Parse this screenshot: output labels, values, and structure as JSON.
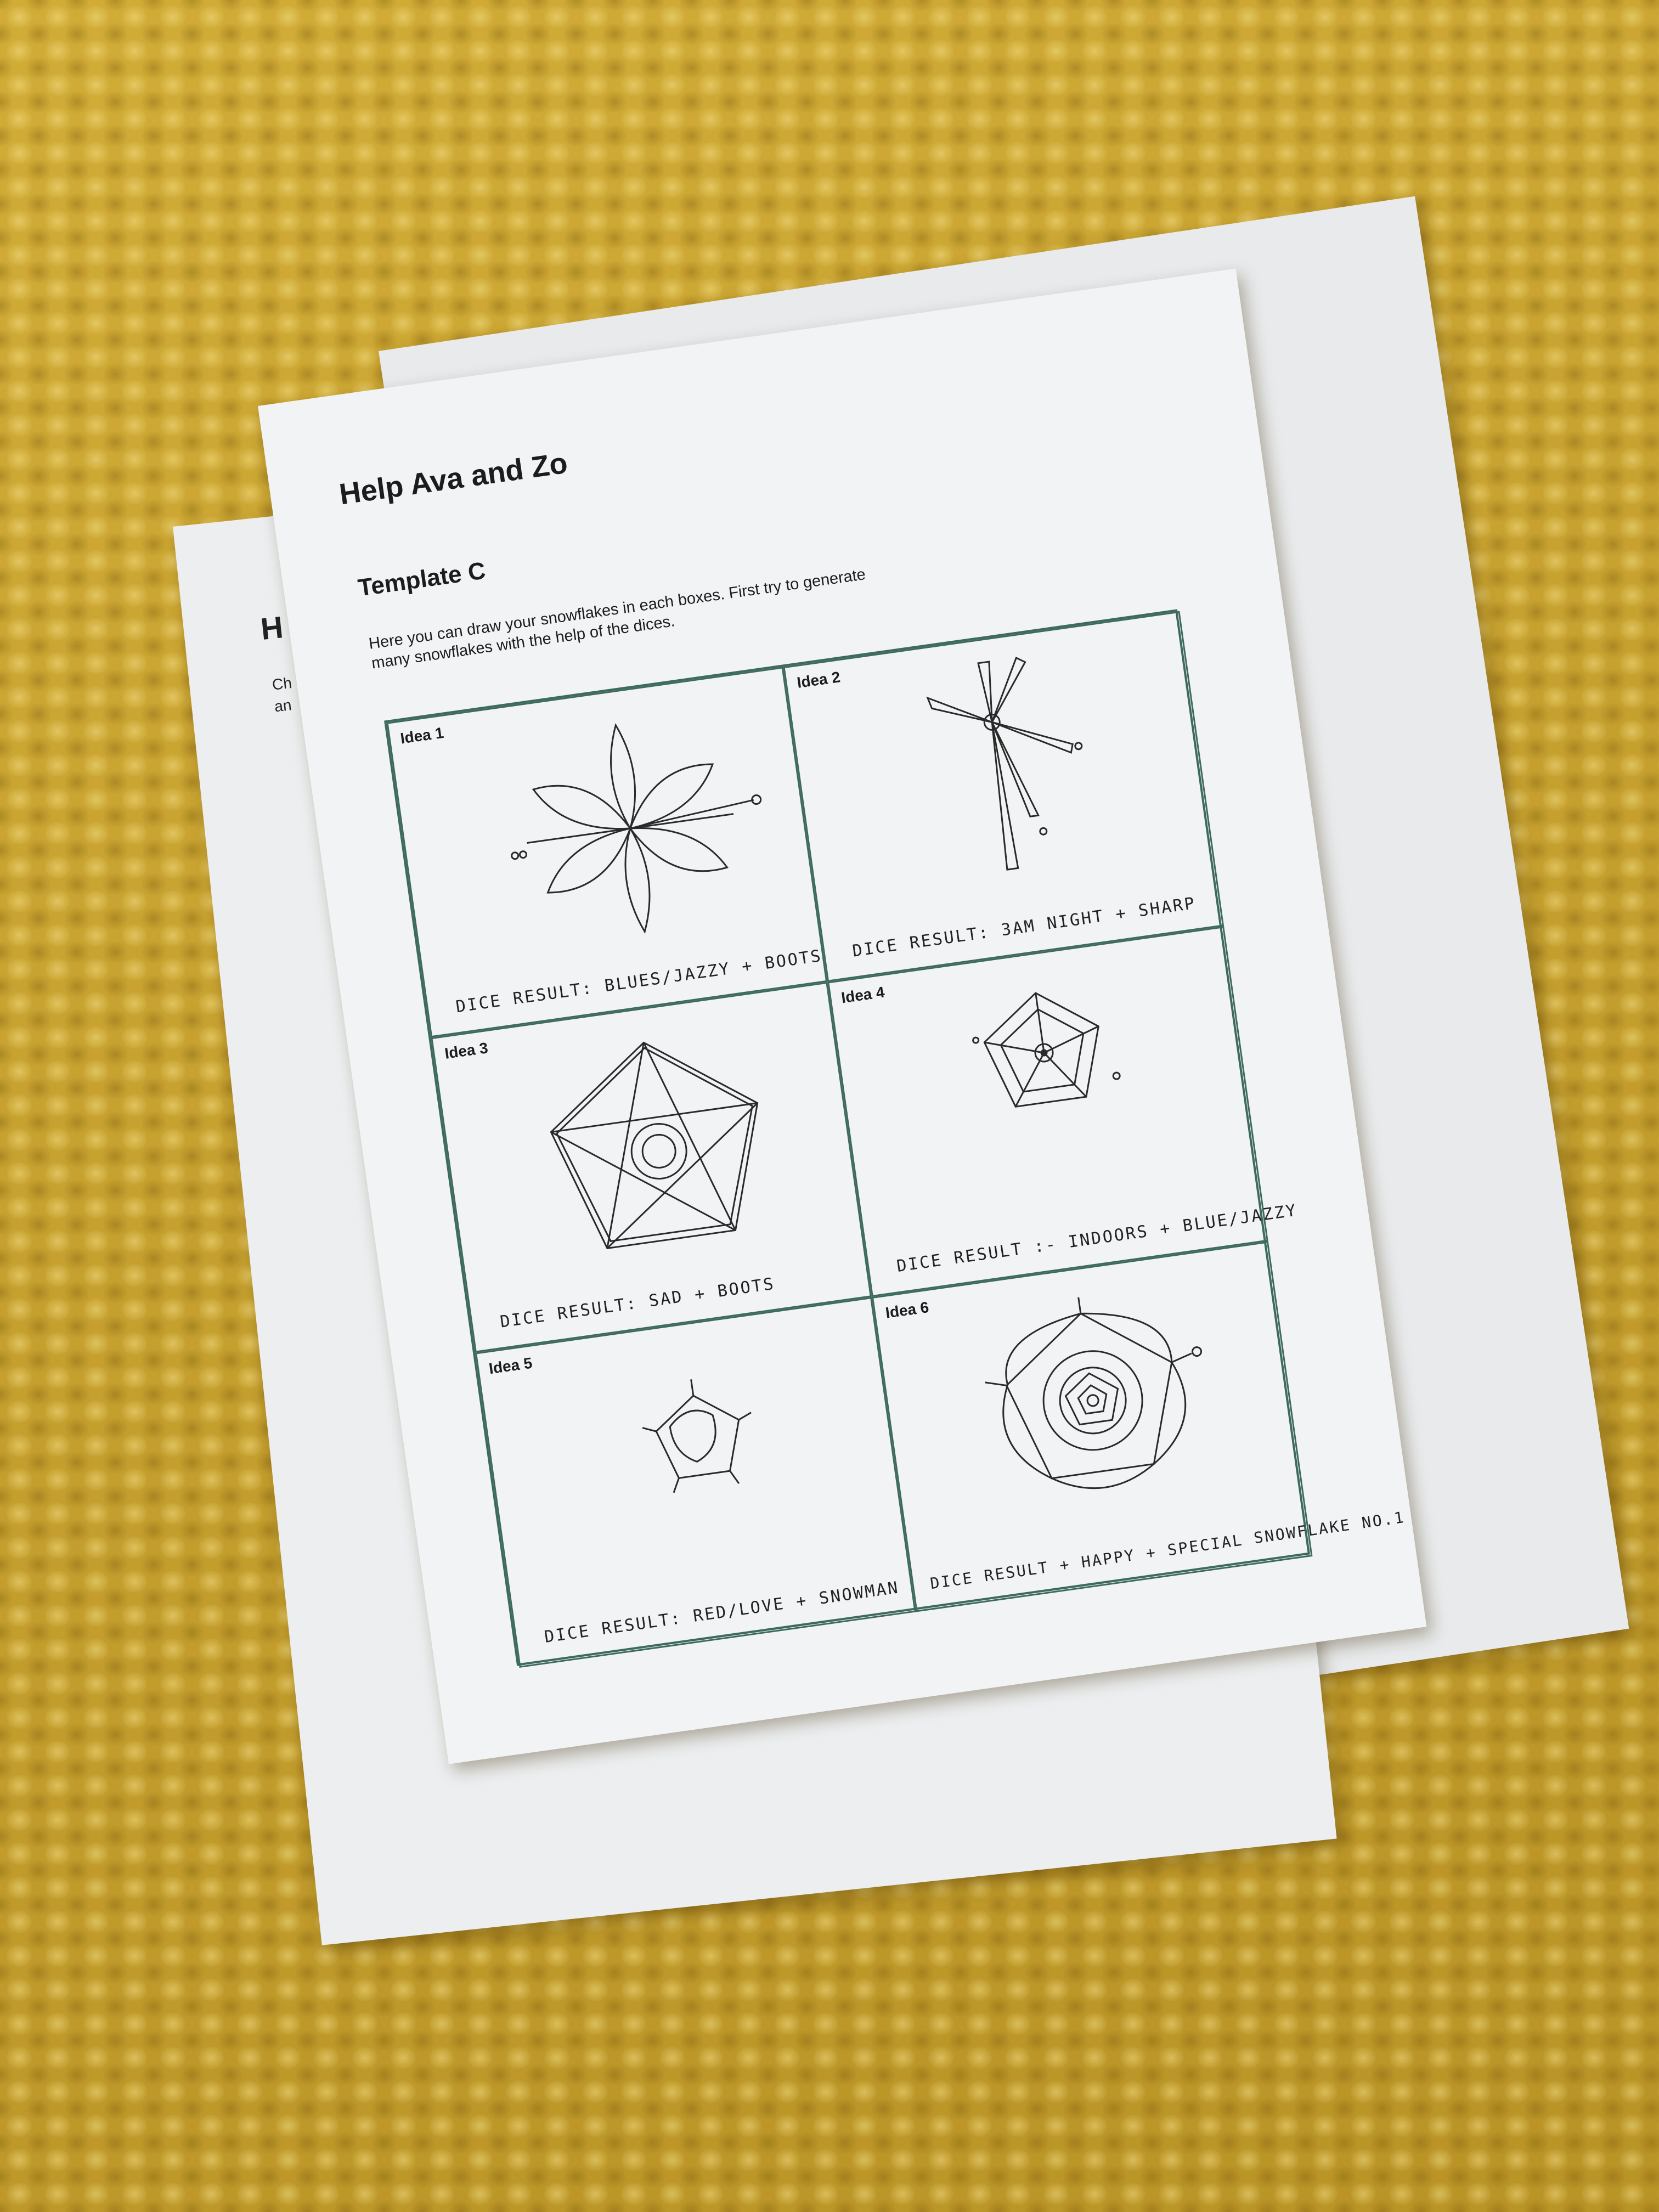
{
  "document": {
    "title": "Help Ava and Zo",
    "subtitle": "Template C",
    "description": "Here you can draw your snowflakes in each boxes. First try to generate many snowflakes with the help of the dices.",
    "ideas": [
      {
        "label": "Idea 1",
        "result": "DICE RESULT: BLUES/JAZZY + BOOTS",
        "sketch": "six-petal-snowflake"
      },
      {
        "label": "Idea 2",
        "result": "DICE RESULT: 3AM NIGHT + SHARP",
        "sketch": "spiky-snowflake"
      },
      {
        "label": "Idea 3",
        "result": "DICE RESULT: SAD + BOOTS",
        "sketch": "pentagon-web-snowflake"
      },
      {
        "label": "Idea 4",
        "result": "DICE RESULT :- INDOORS + BLUE/JAZZY",
        "sketch": "small-pentagon-snowflake"
      },
      {
        "label": "Idea 5",
        "result": "DICE RESULT: RED/LOVE + SNOWMAN",
        "sketch": "tiny-pentagon-snowflake"
      },
      {
        "label": "Idea 6",
        "result": "DICE RESULT + HAPPY + SPECIAL SNOWFLAKE NO.1",
        "sketch": "layered-pentagon-snowflake"
      }
    ]
  },
  "background_pages": {
    "fragment_title": "H",
    "fragment_lines": [
      "Ch",
      "an"
    ]
  },
  "colors": {
    "rug": "#c9a22c",
    "paper": "#f1f3f4",
    "grid_line": "#3e6a5c",
    "ink": "#222222"
  }
}
